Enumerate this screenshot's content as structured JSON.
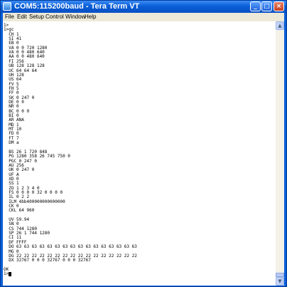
{
  "window": {
    "title": "COM5:115200baud - Tera Term VT",
    "minimize_icon": "minimize-icon",
    "maximize_icon": "maximize-icon",
    "close_icon": "close-icon"
  },
  "menu": [
    {
      "label": "File"
    },
    {
      "label": "Edit"
    },
    {
      "label": "Setup"
    },
    {
      "label": "Control"
    },
    {
      "label": "Window"
    },
    {
      "label": "Help"
    }
  ],
  "terminal": {
    "lines": [
      "1>",
      "1>gc",
      "  CH 1",
      "  SI 41",
      "  EB 0",
      "  VA 0 0 720 1280",
      "  VA 0 0 480 640",
      "  AA 0 0 480 640",
      "  FI 256",
      "  UB 128 128 128",
      "  UC 64 64 64",
      "  UH 128",
      "  US 64",
      "  FV 5",
      "  FH 5",
      "  FF 0",
      "  SK 0 247 0",
      "  DE 0 0",
      "  NR 0",
      "  BC 0 0 0",
      "  BI 0",
      "  AR ANA",
      "  MD 1",
      "  MT 10",
      "  FD 0",
      "  FT 7",
      "  DM a",
      "",
      "  BS 26 1 720 848",
      "  PG 1280 358 26 745 750 0",
      "  PGC 0 247 0",
      "  AU 256",
      "  UK 0 247 0",
      "  UF A",
      "  XD 0",
      "  SS 1",
      "  ZO 1 2 3 4 0",
      "  FS 0 0 0 0 32 0 0 0 0",
      "  IL 0 2 2",
      "  ILM 4bb400000000000000",
      "  CK 0",
      "  CKL 64 960",
      "",
      "  UV 59.94",
      "  SN 0",
      "  CS 744 1280",
      "  SP 26 1 744 1280",
      "  CI 11",
      "  DF FFFF",
      "  DO 63 63 63 63 63 63 63 63 63 63 63 63 63 63 63 63",
      "  MG 0",
      "  DG 22 22 22 22 22 22 22 22 22 22 22 22 22 22 22 22",
      "  DX 32767 0 0 0 32767 0 0 0 32767",
      "",
      "OK",
      "1>"
    ]
  },
  "scrollbar": {
    "up_icon": "scroll-up-arrow-icon",
    "down_icon": "scroll-down-arrow-icon",
    "up_glyph": "▲",
    "down_glyph": "▼"
  }
}
